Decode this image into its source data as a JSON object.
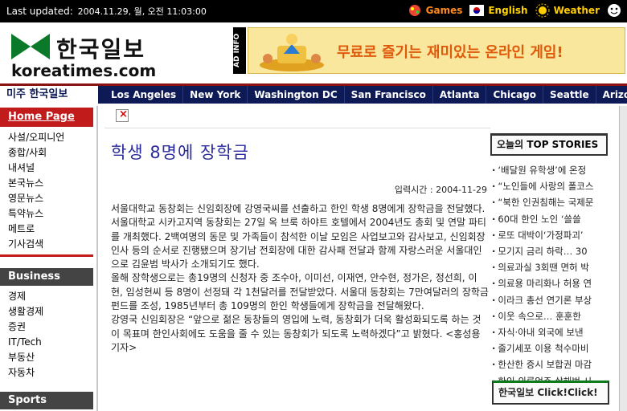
{
  "topbar": {
    "updated_label": "Last updated:",
    "timestamp": "2004.11.29, 월, 오전 11:03:00",
    "links": {
      "games": "Games",
      "english": "English",
      "weather": "Weather"
    },
    "colors": {
      "games": "#ff8a1c",
      "english": "#ffd400",
      "weather": "#ffcc00"
    }
  },
  "header": {
    "logo_korean": "한국일보",
    "logo_english": "koreatimes.com",
    "ad_info": "AD INFO",
    "ad_text": "무료로 즐기는 재미있는 온라인 게임!"
  },
  "citynav": {
    "section": "미주 한국일보",
    "cities": [
      "Los Angeles",
      "New York",
      "Washington DC",
      "San Francisco",
      "Atlanta",
      "Chicago",
      "Seattle",
      "Arizona"
    ]
  },
  "sidebar": {
    "home": "Home Page",
    "items": [
      "사설/오피니언",
      "종합/사회",
      "내셔널",
      "본국뉴스",
      "영문뉴스",
      "특약뉴스",
      "메트로",
      "기사검색"
    ],
    "business_head": "Business",
    "business_items": [
      "경제",
      "생활경제",
      "증권",
      "IT/Tech",
      "부동산",
      "자동차"
    ],
    "sports_head": "Sports"
  },
  "article": {
    "headline": "학생 8명에 장학금",
    "pubtime": "입력시간 : 2004-11-29",
    "body": "서울대학교 동창회는 신임회장에 강영국씨를 선출하고 한인 학생 8명에게 장학금을 전달했다.\n서울대학교 시카고지역 동창회는 27일 옥 브룩 하야트 호텔에서 2004년도 총회 및 연말 파티를 개최했다. 2백여명의 동문 및 가족들이 참석한 이날 모임은 사업보고와 감사보고, 신임회장 인사 등의 순서로 진행됐으며 장기남 전회장에 대한 감사패 전달과 함께 자랑스러운 서울대인으로 김윤범 박사가 소개되기도 했다.\n올해 장학생으로는 총19명의 신청자 중 조수아, 이미선, 이재연, 안수현, 정가은, 정선희, 이현, 임성현씨 등 8명이 선정돼 각 1천달러를 전달받았다. 서울대 동창회는 7만여달러의 장학금 펀드를 조성, 1985년부터 총 109명의 한인 학생들에게 장학금을 전달해왔다.\n강영국 신임회장은 “앞으로 젊은 동창들의 영입에 노력, 동창회가 더욱 활성화되도록 하는 것이 목표며 한인사회에도 도움을 줄 수 있는 동창회가 되도록 노력하겠다”고 밝혔다. <홍성용 기자>"
  },
  "right": {
    "top_stories_prefix": "오늘의",
    "top_stories_title": "TOP STORIES",
    "stories": [
      "‘배달원 유학생’에 온정",
      "“노인들에 사랑의 폴코스",
      "“북한 인권침해는 국제문",
      "60대 한인 노인 ‘쓸쓸",
      "로또 대박이‘가정파괴’",
      "모기지 금리 하락… 30",
      "의료과실 3회땐 면허 박",
      "의료용 마리화나 허용 연",
      "이라크 총선 연기론 부상",
      "이웃 속으로… 훈훈한",
      "자식·아내 외국에 보낸",
      "줄기세포 이용 척수마비",
      "한산한 증시 보합권 마감",
      "한인 의류업주 살해범 시"
    ],
    "click_label": "한국일보 Click!Click!"
  }
}
